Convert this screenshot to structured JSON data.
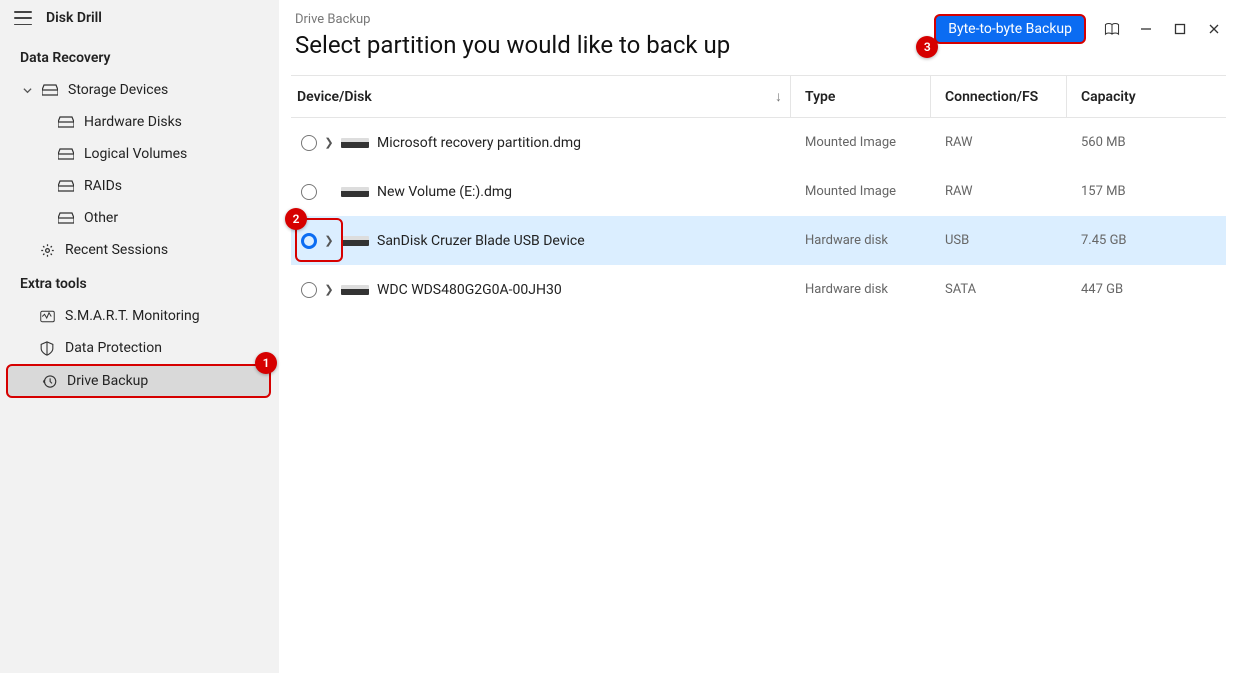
{
  "app": {
    "title": "Disk Drill"
  },
  "sidebar": {
    "sections": [
      {
        "label": "Data Recovery",
        "items": [
          {
            "label": "Storage Devices",
            "icon": "drive",
            "expanded": true,
            "children": [
              {
                "label": "Hardware Disks",
                "icon": "drive"
              },
              {
                "label": "Logical Volumes",
                "icon": "drive"
              },
              {
                "label": "RAIDs",
                "icon": "drive"
              },
              {
                "label": "Other",
                "icon": "drive"
              }
            ]
          },
          {
            "label": "Recent Sessions",
            "icon": "gear"
          }
        ]
      },
      {
        "label": "Extra tools",
        "items": [
          {
            "label": "S.M.A.R.T. Monitoring",
            "icon": "activity"
          },
          {
            "label": "Data Protection",
            "icon": "shield"
          },
          {
            "label": "Drive Backup",
            "icon": "history",
            "selected": true,
            "callout": 1
          }
        ]
      }
    ]
  },
  "header": {
    "crumb": "Drive Backup",
    "title": "Select partition you would like to back up",
    "byte_button": "Byte-to-byte Backup"
  },
  "table": {
    "columns": {
      "device": "Device/Disk",
      "type": "Type",
      "conn": "Connection/FS",
      "cap": "Capacity"
    },
    "rows": [
      {
        "name": "Microsoft recovery partition.dmg",
        "type": "Mounted Image",
        "conn": "RAW",
        "cap": "560 MB",
        "expandable": true,
        "selected": false
      },
      {
        "name": "New Volume (E:).dmg",
        "type": "Mounted Image",
        "conn": "RAW",
        "cap": "157 MB",
        "expandable": false,
        "selected": false
      },
      {
        "name": "SanDisk Cruzer Blade USB Device",
        "type": "Hardware disk",
        "conn": "USB",
        "cap": "7.45 GB",
        "expandable": true,
        "selected": true,
        "callout": 2
      },
      {
        "name": "WDC WDS480G2G0A-00JH30",
        "type": "Hardware disk",
        "conn": "SATA",
        "cap": "447 GB",
        "expandable": true,
        "selected": false
      }
    ]
  },
  "callouts": {
    "c1": "1",
    "c2": "2",
    "c3": "3"
  }
}
